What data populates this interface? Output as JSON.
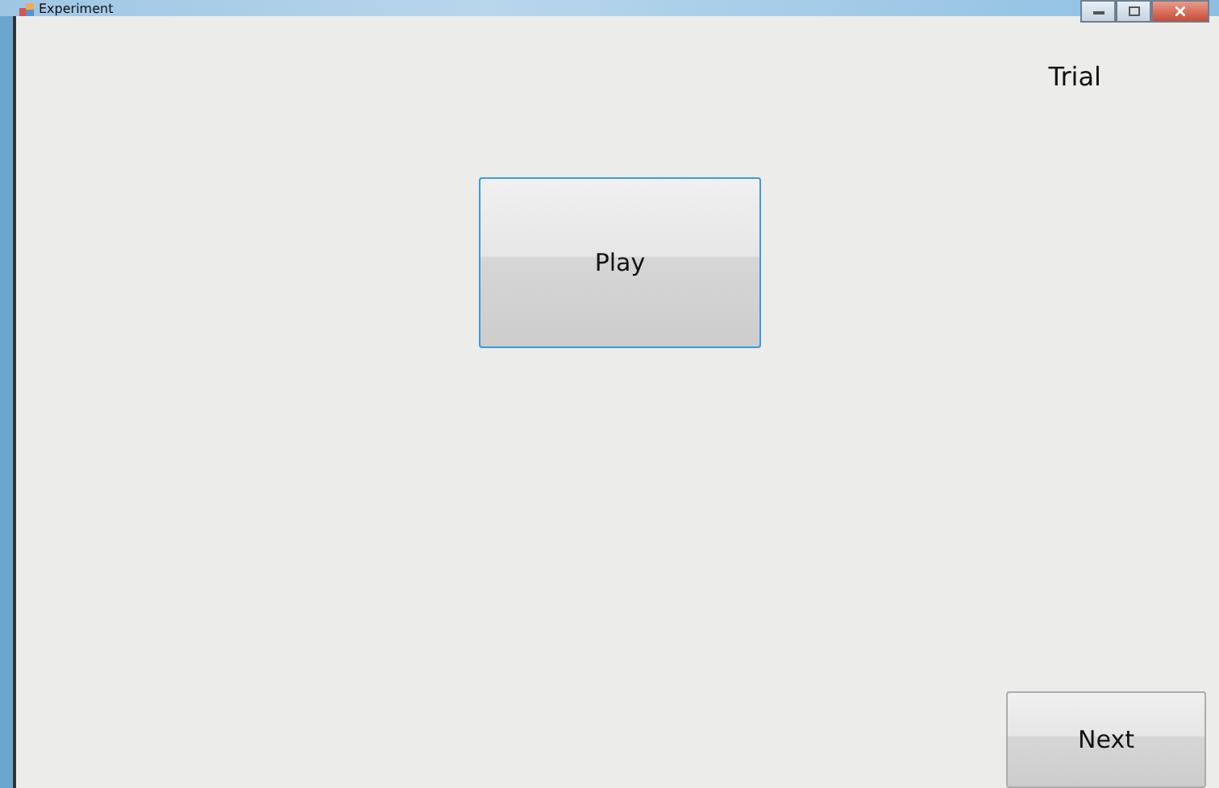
{
  "window": {
    "title": "Experiment"
  },
  "label": "Trial",
  "buttons": [
    {
      "label": "Play",
      "focused": true
    },
    {
      "label": "Next",
      "focused": false
    }
  ]
}
